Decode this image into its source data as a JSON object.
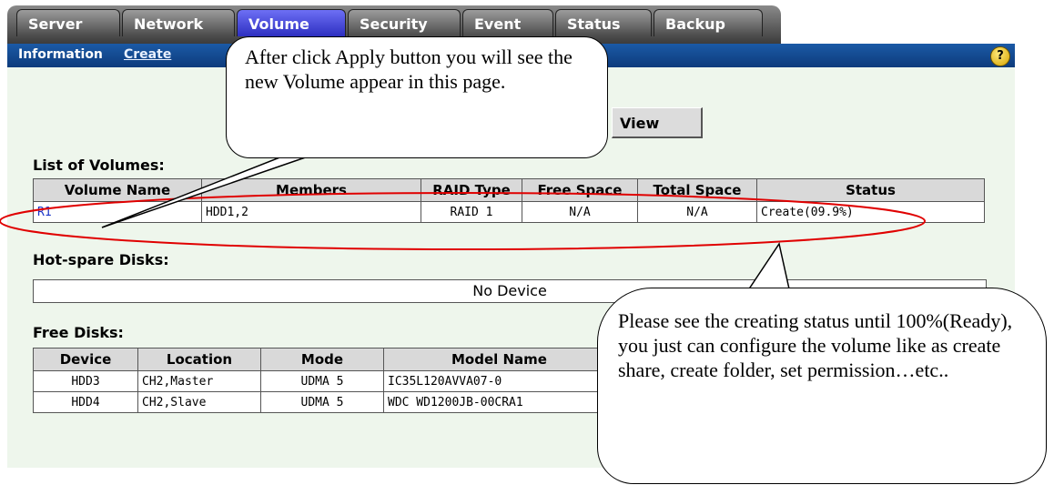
{
  "tabs": [
    {
      "label": "Server"
    },
    {
      "label": "Network"
    },
    {
      "label": "Volume"
    },
    {
      "label": "Security"
    },
    {
      "label": "Event"
    },
    {
      "label": "Status"
    },
    {
      "label": "Backup"
    }
  ],
  "subnav": {
    "information": "Information",
    "create": "Create",
    "help": "?"
  },
  "view_button": "View",
  "volumes": {
    "title": "List of Volumes:",
    "headers": [
      "Volume Name",
      "Members",
      "RAID Type",
      "Free Space",
      "Total Space",
      "Status"
    ],
    "rows": [
      [
        "R1",
        "HDD1,2",
        "RAID 1",
        "N/A",
        "N/A",
        "Create(09.9%)"
      ]
    ]
  },
  "hotspare": {
    "title": "Hot-spare Disks:",
    "empty": "No Device"
  },
  "freedisks": {
    "title": "Free Disks:",
    "headers": [
      "Device",
      "Location",
      "Mode",
      "Model Name"
    ],
    "rows": [
      [
        "HDD3",
        "CH2,Master",
        "UDMA 5",
        "IC35L120AVVA07-0"
      ],
      [
        "HDD4",
        "CH2,Slave",
        "UDMA 5",
        "WDC WD1200JB-00CRA1"
      ]
    ]
  },
  "callouts": {
    "apply": "After click Apply button you will see the new Volume appear in this page.",
    "status": "Please see the creating status until 100%(Ready), you just can configure the volume like as create share, create folder, set permission…etc.."
  },
  "colors": {
    "tab_bg": "#4a4a4a",
    "active_tab": "#3b3bd6",
    "subnav": "#0d3b7c",
    "content_bg": "#eef6ec",
    "highlight": "#e00000"
  }
}
